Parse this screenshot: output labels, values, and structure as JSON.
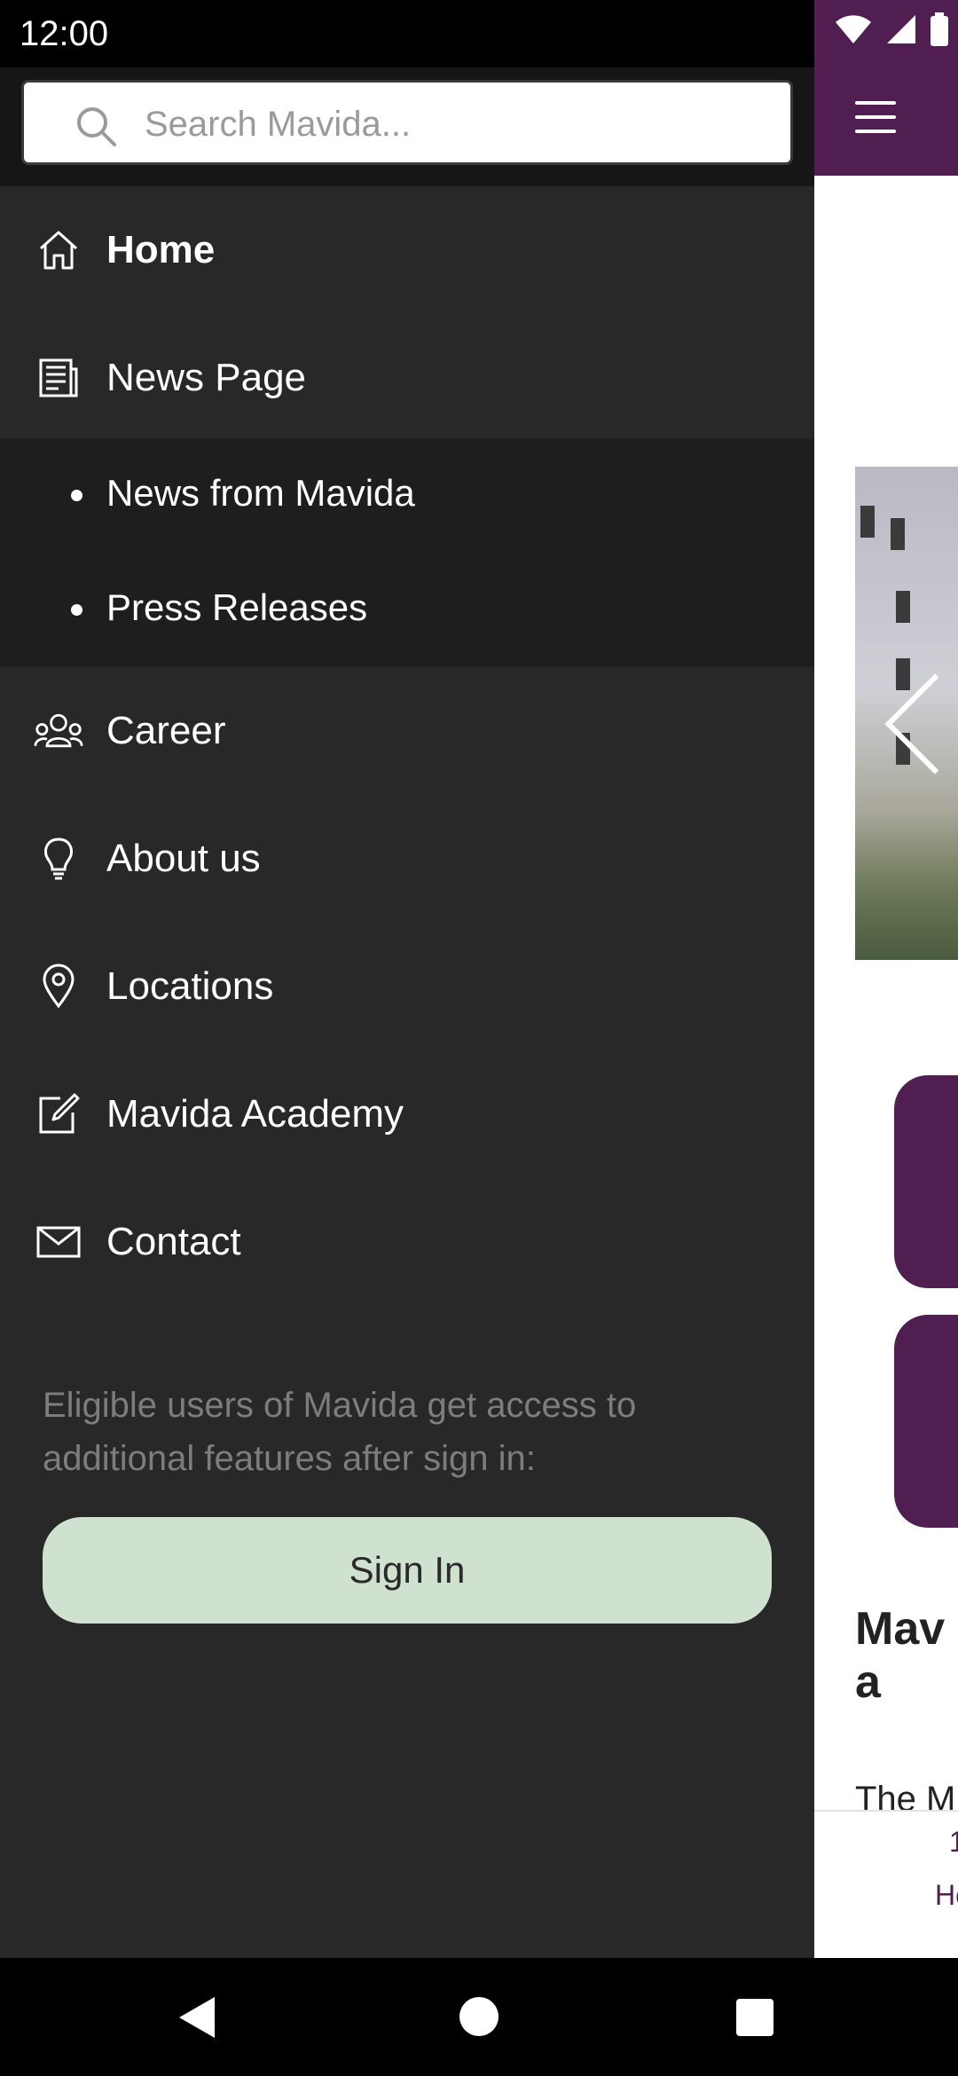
{
  "status_bar": {
    "time": "12:00"
  },
  "search": {
    "placeholder": "Search Mavida..."
  },
  "menu": {
    "home": "Home",
    "news_page": "News Page",
    "news_sub": [
      "News from Mavida",
      "Press Releases"
    ],
    "career": "Career",
    "about": "About us",
    "locations": "Locations",
    "academy": "Mavida Academy",
    "contact": "Contact"
  },
  "drawer_footer": {
    "eligible_text": "Eligible users of Mavida get access to additional features after sign in:",
    "sign_in_label": "Sign In"
  },
  "background_app": {
    "title_fragment": "Mav old a",
    "text_fragment": "The M",
    "bottom_nav_label_fragment": "Ho",
    "bottom_nav_num_fragment": "1"
  },
  "colors": {
    "brand_purple": "#511e51",
    "drawer_bg": "#282828",
    "sign_in_bg": "#cfe2cf"
  },
  "icons": [
    "search-icon",
    "home-icon",
    "newspaper-icon",
    "career-icon",
    "lightbulb-icon",
    "location-pin-icon",
    "edit-icon",
    "mail-icon",
    "hamburger-icon",
    "wifi-icon",
    "signal-icon",
    "battery-icon"
  ]
}
